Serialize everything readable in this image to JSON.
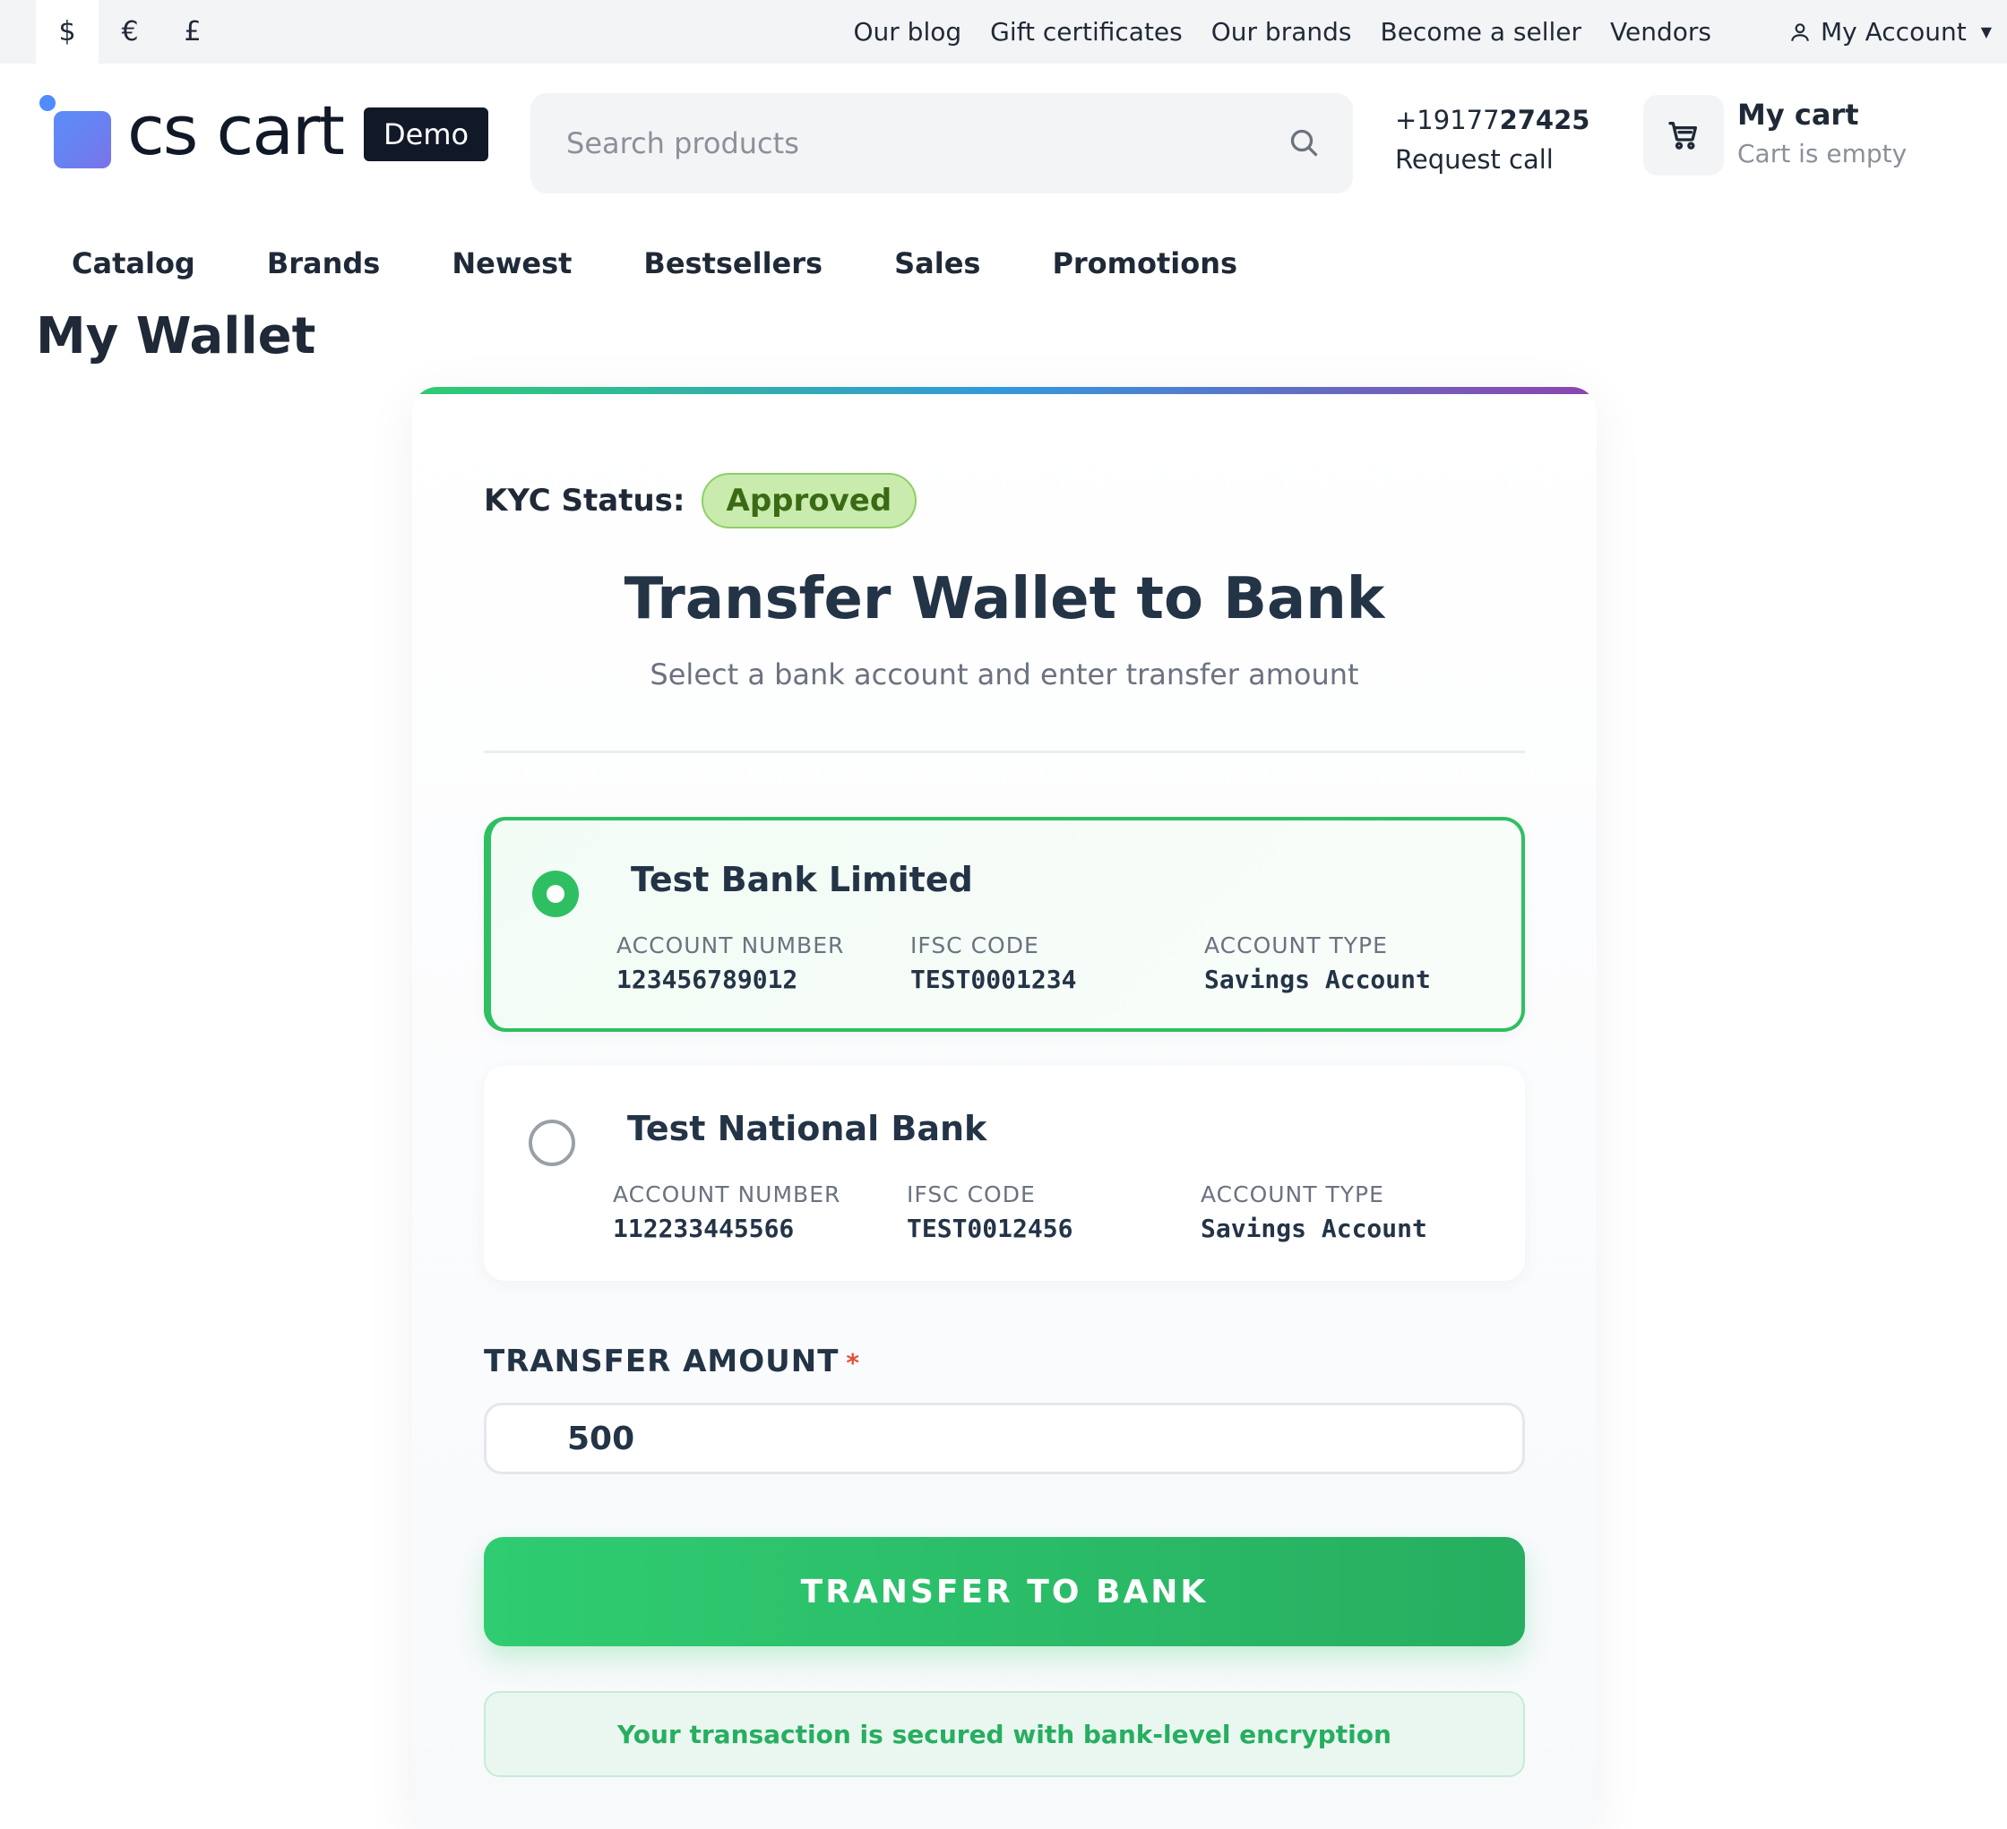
{
  "topbar": {
    "currencies": [
      {
        "symbol": "$",
        "active": true
      },
      {
        "symbol": "€",
        "active": false
      },
      {
        "symbol": "£",
        "active": false
      }
    ],
    "links": [
      "Our blog",
      "Gift certificates",
      "Our brands",
      "Become a seller",
      "Vendors"
    ],
    "account_label": "My Account"
  },
  "header": {
    "logo_text": "cs cart",
    "logo_badge": "Demo",
    "search_placeholder": "Search products",
    "phone_prefix": "+19177",
    "phone_bold": "27425",
    "request_call": "Request call",
    "cart_title": "My cart",
    "cart_status": "Cart is empty"
  },
  "nav": [
    "Catalog",
    "Brands",
    "Newest",
    "Bestsellers",
    "Sales",
    "Promotions"
  ],
  "page_title": "My Wallet",
  "card": {
    "kyc_label": "KYC Status:",
    "kyc_status": "Approved",
    "heading": "Transfer Wallet to Bank",
    "subheading": "Select a bank account and enter transfer amount",
    "field_labels": {
      "account_number": "ACCOUNT NUMBER",
      "ifsc": "IFSC CODE",
      "account_type": "ACCOUNT TYPE"
    },
    "banks": [
      {
        "name": "Test Bank Limited",
        "account_number": "123456789012",
        "ifsc": "TEST0001234",
        "account_type": "Savings Account",
        "selected": true
      },
      {
        "name": "Test National Bank",
        "account_number": "112233445566",
        "ifsc": "TEST0012456",
        "account_type": "Savings Account",
        "selected": false
      }
    ],
    "amount_label": "TRANSFER AMOUNT",
    "amount_required_mark": "*",
    "amount_value": "500",
    "submit_label": "TRANSFER TO BANK",
    "secure_note": "Your transaction is secured with bank-level encryption"
  },
  "colors": {
    "accent_green": "#2fbf63",
    "kyc_badge_bg": "#c9ecae",
    "kyc_badge_text": "#3a6b14",
    "required_red": "#e74c3c"
  }
}
